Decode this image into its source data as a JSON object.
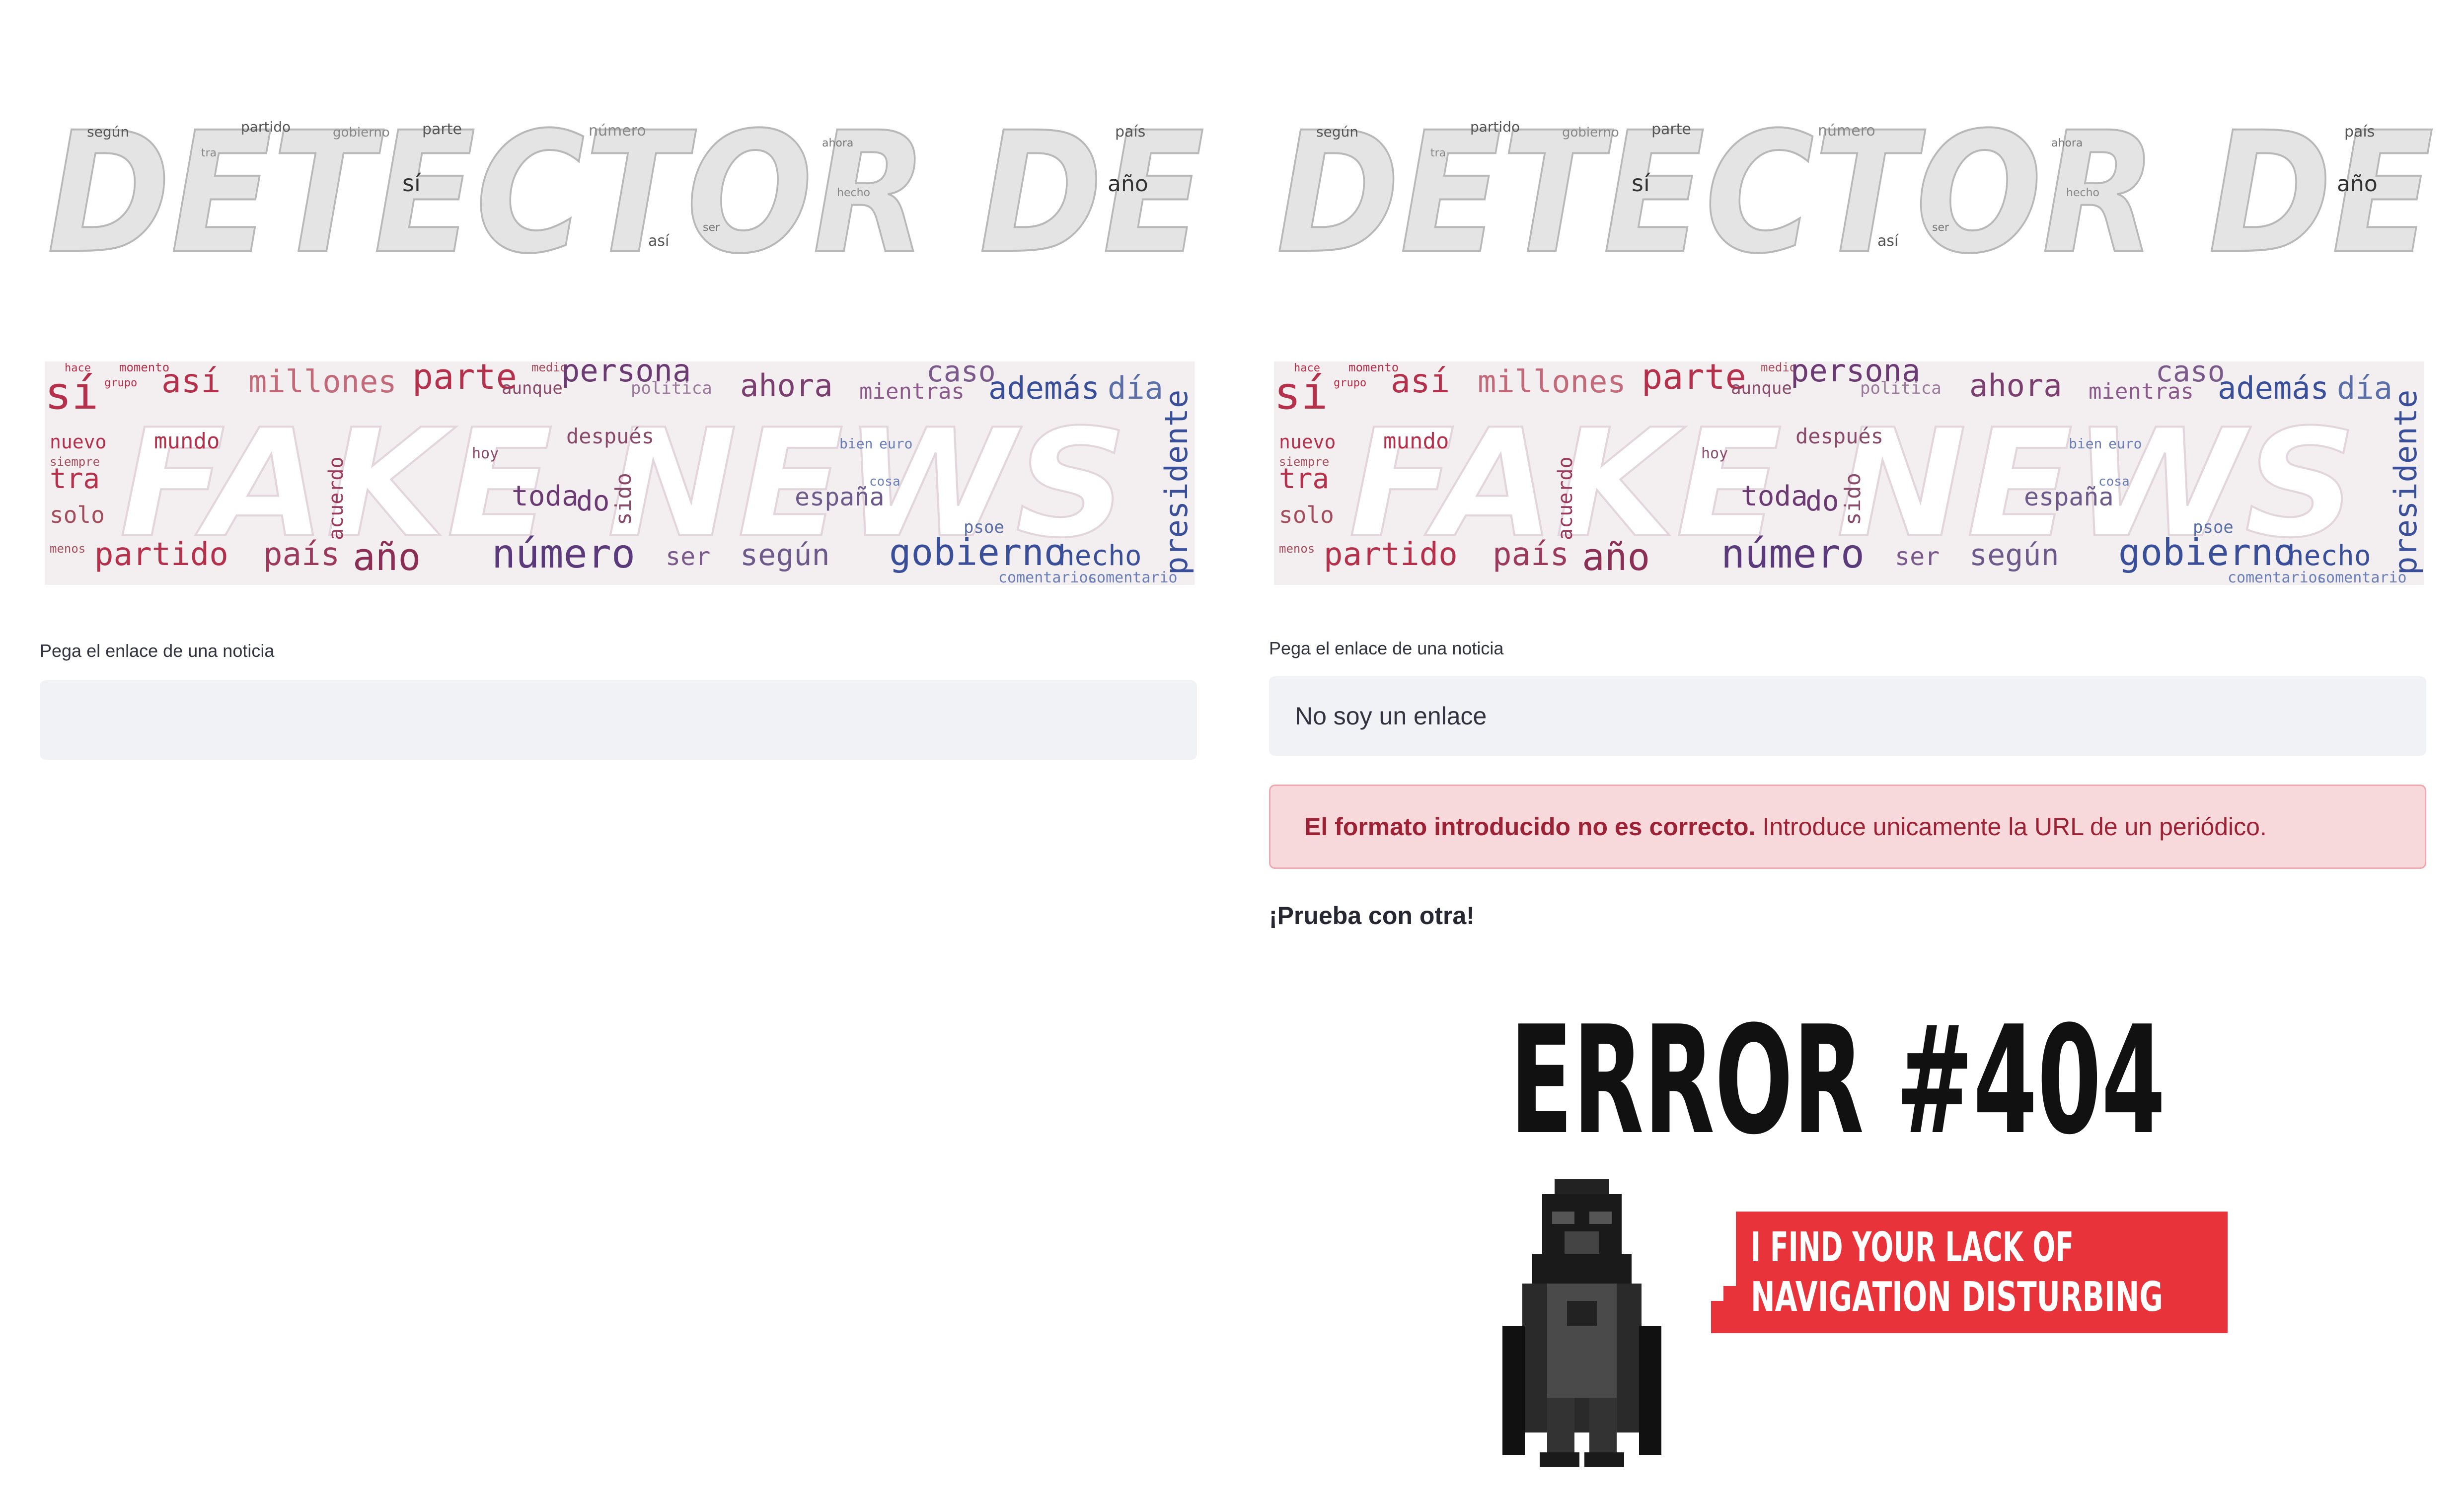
{
  "title_image": {
    "heading": "DETECTOR DE",
    "words": [
      "según",
      "partido",
      "gobierno",
      "parte",
      "número",
      "ahora",
      "país",
      "así",
      "sí",
      "año",
      "tra",
      "hecho",
      "ser"
    ],
    "color": "#9a9a9a"
  },
  "cloud_image": {
    "heading": "FAKE NEWS",
    "words_red": [
      "sí",
      "así",
      "millones",
      "parte",
      "tra",
      "solo",
      "partido",
      "país",
      "año",
      "nuevo",
      "mundo",
      "acuerdo",
      "medio",
      "hace",
      "momento",
      "grupo",
      "menos",
      "siempre"
    ],
    "words_purple": [
      "persona",
      "ahora",
      "número",
      "caso",
      "mientras",
      "después",
      "sido",
      "toda",
      "do",
      "ser",
      "según",
      "españa",
      "hoy",
      "aunque",
      "política"
    ],
    "words_blue": [
      "además",
      "día",
      "presidente",
      "gobierno",
      "hecho",
      "comentarios",
      "comentario",
      "psoe",
      "bien",
      "euro",
      "cosa"
    ],
    "colors": {
      "red": "#b5304a",
      "purple": "#6b3a73",
      "blue": "#3a4f9a",
      "bg": "#f3eef0"
    }
  },
  "left_panel": {
    "label": "Pega el enlace de una noticia",
    "input_value": ""
  },
  "right_panel": {
    "label": "Pega el enlace de una noticia",
    "input_value": "No soy un enlace",
    "alert_bold": "El formato introducido no es correcto.",
    "alert_text": "Introduce unicamente la URL de un periódico.",
    "retry": "¡Prueba con otra!"
  },
  "error_image": {
    "code": "ERROR #404",
    "banner_line1": "I FIND YOUR LACK OF",
    "banner_line2": "NAVIGATION DISTURBING",
    "banner_color": "#e8333a"
  }
}
